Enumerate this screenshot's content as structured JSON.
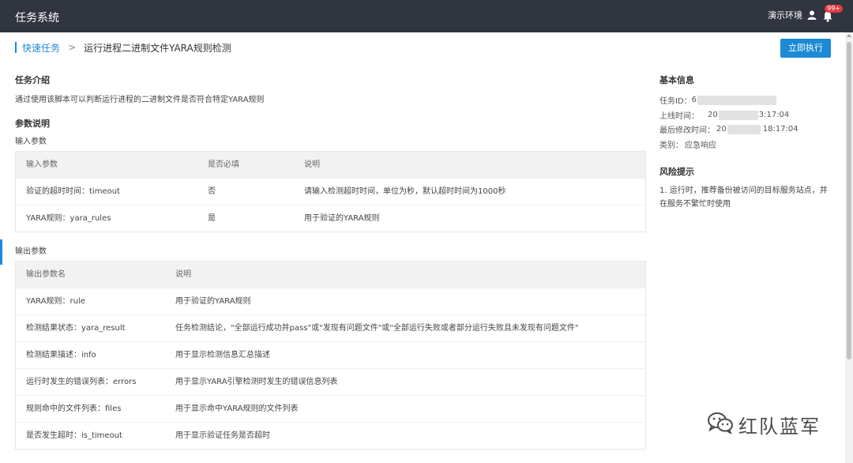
{
  "topbar": {
    "app_title": "任务系统",
    "env_label": "演示环境",
    "user_icon": "user-icon",
    "bell_icon": "bell-icon",
    "notification_badge": "99+"
  },
  "breadcrumb": {
    "parent": "快速任务",
    "separator": ">",
    "current": "运行进程二进制文件YARA规则检测"
  },
  "actions": {
    "run_label": "立即执行"
  },
  "intro": {
    "title": "任务介绍",
    "text": "通过使用该脚本可以判断运行进程的二进制文件是否符合特定YARA规则"
  },
  "params": {
    "title": "参数说明",
    "input_title": "输入参数",
    "input_table": {
      "headers": [
        "输入参数",
        "是否必填",
        "说明"
      ],
      "rows": [
        [
          "验证的超时时间：timeout",
          "否",
          "请输入检测超时时间，单位为秒，默认超时时间为1000秒"
        ],
        [
          "YARA规则：yara_rules",
          "是",
          "用于验证的YARA规则"
        ]
      ]
    },
    "output_title": "输出参数",
    "output_table": {
      "headers": [
        "输出参数名",
        "说明"
      ],
      "rows": [
        [
          "YARA规则：rule",
          "用于验证的YARA规则"
        ],
        [
          "检测结果状态：yara_result",
          "任务检测结论，\"全部运行成功并pass\"或\"发现有问题文件\"或\"全部运行失败或者部分运行失败且未发现有问题文件\""
        ],
        [
          "检测结果描述：info",
          "用于显示检测信息汇总描述"
        ],
        [
          "运行时发生的错误列表：errors",
          "用于显示YARA引擎检测时发生的错误信息列表"
        ],
        [
          "规则命中的文件列表：files",
          "用于显示命中YARA规则的文件列表"
        ],
        [
          "是否发生超时：is_timeout",
          "用于显示验证任务是否超时"
        ]
      ]
    }
  },
  "basic_info": {
    "title": "基本信息",
    "task_id_label": "任务ID：",
    "task_id_visible": "6",
    "online_label": "上线时间：",
    "online_prefix": "20",
    "online_suffix": "3:17:04",
    "modified_label": "最后修改时间：",
    "modified_prefix": "20",
    "modified_suffix": "18:17:04",
    "category_label": "类别：",
    "category_value": "应急响应"
  },
  "risk": {
    "title": "风险提示",
    "text": "1. 运行时，推荐备份被访问的目标服务站点，并在服务不繁忙时使用"
  },
  "watermark": {
    "text": "红队蓝军",
    "icon": "wechat-icon"
  },
  "colors": {
    "topbar": "#30353f",
    "accent": "#1c8ad6",
    "badge": "#e6393f"
  }
}
